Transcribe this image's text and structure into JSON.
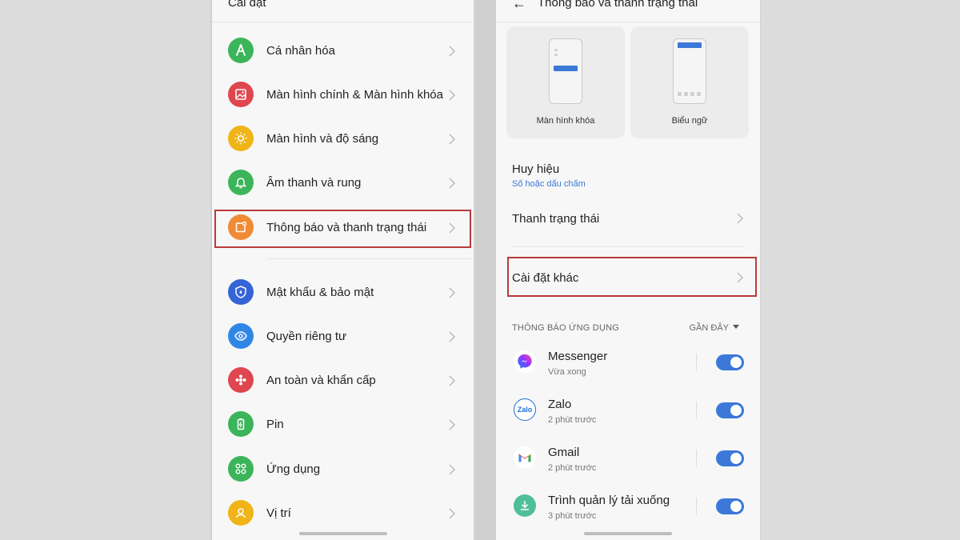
{
  "left": {
    "title": "Cài đặt",
    "items": [
      {
        "label": "Cá nhân hóa",
        "color": "#3cb55a",
        "icon": "personalize-icon"
      },
      {
        "label": "Màn hình chính & Màn hình khóa",
        "color": "#e0464f",
        "icon": "wallpaper-icon"
      },
      {
        "label": "Màn hình và độ sáng",
        "color": "#f0b417",
        "icon": "brightness-icon"
      },
      {
        "label": "Âm thanh và rung",
        "color": "#3cb55a",
        "icon": "bell-icon"
      },
      {
        "label": "Thông báo và thanh trạng thái",
        "color": "#f08a35",
        "icon": "notification-icon"
      },
      {
        "label": "Mật khẩu & bảo mật",
        "color": "#3464d6",
        "icon": "shield-icon"
      },
      {
        "label": "Quyền riêng tư",
        "color": "#2f86e6",
        "icon": "privacy-eye-icon"
      },
      {
        "label": "An toàn và khẩn cấp",
        "color": "#e0464f",
        "icon": "emergency-icon"
      },
      {
        "label": "Pin",
        "color": "#3cb55a",
        "icon": "battery-icon"
      },
      {
        "label": "Ứng dụng",
        "color": "#3cb55a",
        "icon": "apps-grid-icon"
      },
      {
        "label": "Vị trí",
        "color": "#f0b417",
        "icon": "location-icon"
      }
    ]
  },
  "right": {
    "title": "Thông báo và thanh trạng thái",
    "cards": [
      {
        "label": "Màn hình khóa"
      },
      {
        "label": "Biểu ngữ"
      }
    ],
    "badge": {
      "title": "Huy hiệu",
      "subtitle": "Số hoặc dấu chấm"
    },
    "status_bar": "Thanh trạng thái",
    "other_settings": "Cài đặt khác",
    "section_header": "THÔNG BÁO ỨNG DỤNG",
    "sort_label": "GẦN ĐÂY",
    "apps": [
      {
        "name": "Messenger",
        "time": "Vừa xong",
        "enabled": true
      },
      {
        "name": "Zalo",
        "time": "2 phút trước",
        "enabled": true,
        "icon_text": "Zalo"
      },
      {
        "name": "Gmail",
        "time": "2 phút trước",
        "enabled": true
      },
      {
        "name": "Trình quản lý tải xuống",
        "time": "3 phút trước",
        "enabled": true
      }
    ]
  },
  "colors": {
    "accent": "#3b78d8",
    "highlight_border": "#b83a3a"
  }
}
